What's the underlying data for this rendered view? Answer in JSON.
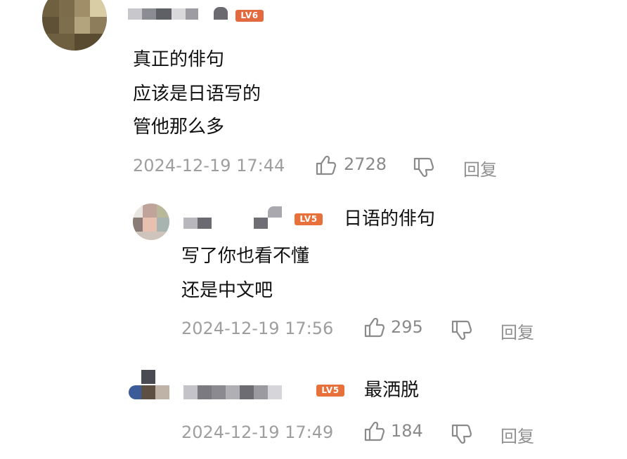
{
  "accent_color": "#e8703a",
  "comments": [
    {
      "level": "LV6",
      "lines": [
        "真正的俳句",
        "应该是日语写的",
        "管他那么多"
      ],
      "timestamp": "2024-12-19 17:44",
      "likes": "2728",
      "reply_label": "回复"
    },
    {
      "level": "LV5",
      "reply_to_text": "日语的俳句",
      "lines": [
        "写了你也看不懂",
        "还是中文吧"
      ],
      "timestamp": "2024-12-19 17:56",
      "likes": "295",
      "reply_label": "回复"
    },
    {
      "level": "LV5",
      "reply_to_text": "最洒脱",
      "lines": [],
      "timestamp": "2024-12-19 17:49",
      "likes": "184",
      "reply_label": "回复"
    }
  ],
  "icons": {
    "like": "thumbs-up-icon",
    "dislike": "thumbs-down-icon"
  }
}
